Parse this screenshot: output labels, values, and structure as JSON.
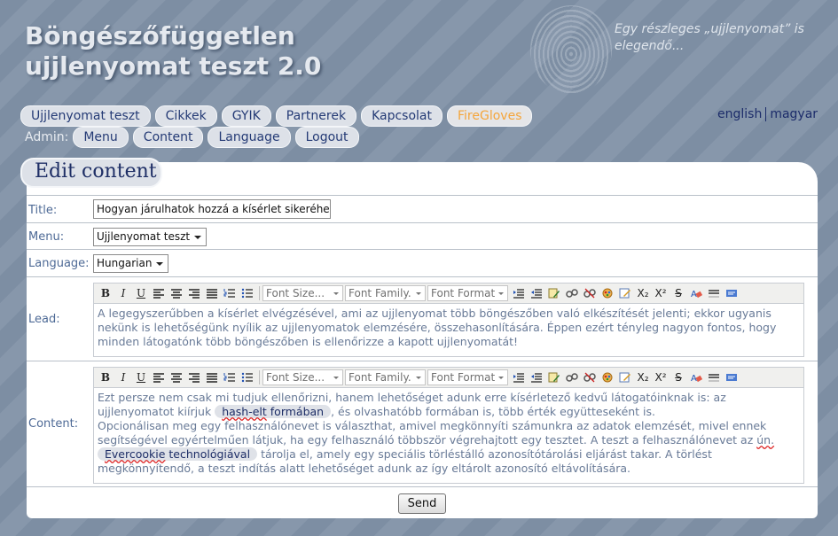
{
  "site": {
    "title_line1": "Böngészőfüggetlen",
    "title_line2": "ujjlenyomat teszt 2.0",
    "tagline": "Egy részleges „ujjlenyomat” is elegendő..."
  },
  "nav": {
    "items": [
      "Ujjlenyomat teszt",
      "Cikkek",
      "GYIK",
      "Partnerek",
      "Kapcsolat",
      "FireGloves"
    ]
  },
  "admin": {
    "label": "Admin:",
    "items": [
      "Menu",
      "Content",
      "Language",
      "Logout"
    ]
  },
  "languages": [
    "english",
    "magyar"
  ],
  "page": {
    "heading": "Edit content"
  },
  "form": {
    "title_label": "Title:",
    "title_value": "Hogyan járulhatok hozzá a kísérlet sikeréhez",
    "menu_label": "Menu:",
    "menu_value": "Ujjlenyomat teszt",
    "language_label": "Language:",
    "language_value": "Hungarian",
    "lead_label": "Lead:",
    "content_label": "Content:",
    "send_label": "Send"
  },
  "toolbar": {
    "font_size": "Font Size...",
    "font_family": "Font Family.",
    "font_format": "Font Format",
    "bold": "B",
    "italic": "I",
    "underline": "U",
    "strike": "S",
    "sub": "X₂",
    "sup": "X²"
  },
  "lead_text": "A legegyszerűbben a kísérlet elvégzésével, ami az ujjlenyomat több böngészőben való elkészítését jelenti; ekkor ugyanis nekünk is lehetőségünk nyílik az ujjlenyomatok elemzésére, összehasonlítására. Éppen ezért tényleg nagyon fontos, hogy minden látogatónk több böngészőben is ellenőrizze a kapott ujjlenyomatát!",
  "content_text": {
    "p1_a": "Ezt persze nem csak mi tudjuk ellenőrizni, hanem lehetőséget adunk erre kísérletező kedvű látogatóinknak is: az ujjlenyomatot kiírjuk",
    "link1_a": "hash-elt",
    "link1_b": " formában",
    "p1_b": ", és olvashatóbb formában is, több érték együtteseként is.",
    "p2_a": "Opcionálisan meg egy felhasználónevet is választhat, amivel megkönnyíti számunkra az adatok elemzését, mivel ennek segítségével egyértelműen látjuk, ha egy felhasználó többször végrehajtott egy tesztet. A teszt a felhasználónevet az",
    "p2_un": "ún.",
    "link2_a": "Evercookie",
    "link2_b": " technológiával",
    "p2_b": "tárolja el, amely egy speciális törléstálló azonosítótárolási eljárást takar. A törlést megkönnyítendő, a teszt indítás alatt lehetőséget adunk az így eltárolt azonosító eltávolítására."
  }
}
